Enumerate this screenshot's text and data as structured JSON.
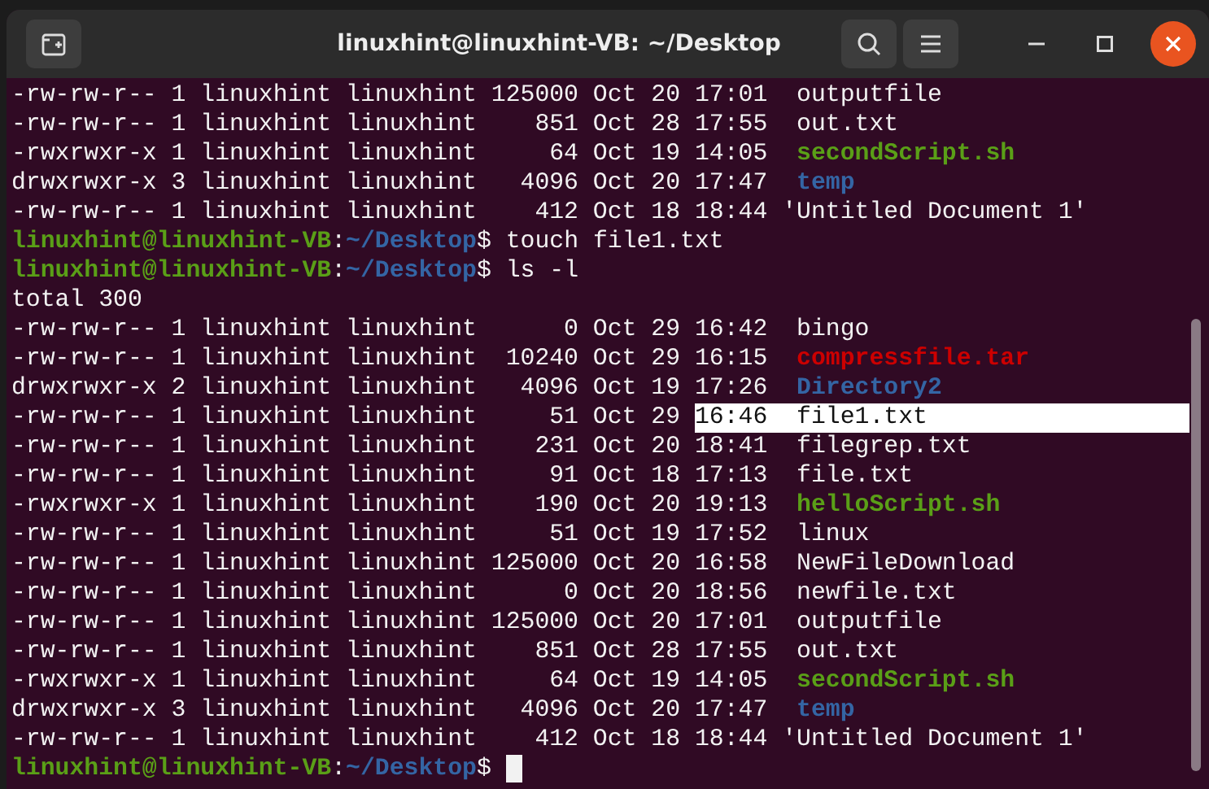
{
  "window": {
    "title": "linuxhint@linuxhint-VB: ~/Desktop"
  },
  "lines": [
    {
      "kind": "listing",
      "info": "-rw-rw-r-- 1 linuxhint linuxhint 125000 Oct 20",
      "time": "17:01",
      "file": {
        "name": "outputfile",
        "kind": "file"
      },
      "quoted": false,
      "selected": false
    },
    {
      "kind": "listing",
      "info": "-rw-rw-r-- 1 linuxhint linuxhint    851 Oct 28",
      "time": "17:55",
      "file": {
        "name": "out.txt",
        "kind": "file"
      },
      "quoted": false,
      "selected": false
    },
    {
      "kind": "listing",
      "info": "-rwxrwxr-x 1 linuxhint linuxhint     64 Oct 19",
      "time": "14:05",
      "file": {
        "name": "secondScript.sh",
        "kind": "executable"
      },
      "quoted": false,
      "selected": false
    },
    {
      "kind": "listing",
      "info": "drwxrwxr-x 3 linuxhint linuxhint   4096 Oct 20",
      "time": "17:47",
      "file": {
        "name": "temp",
        "kind": "directory"
      },
      "quoted": false,
      "selected": false
    },
    {
      "kind": "listing",
      "info": "-rw-rw-r-- 1 linuxhint linuxhint    412 Oct 18",
      "time": "18:44",
      "file": {
        "name": "'Untitled Document 1'",
        "kind": "file"
      },
      "quoted": true,
      "selected": false
    },
    {
      "kind": "prompt",
      "user": "linuxhint@linuxhint-VB",
      "separator": ":",
      "path": "~/Desktop",
      "symbol": "$",
      "command": "touch file1.txt",
      "cursor": false
    },
    {
      "kind": "prompt",
      "user": "linuxhint@linuxhint-VB",
      "separator": ":",
      "path": "~/Desktop",
      "symbol": "$",
      "command": "ls -l",
      "cursor": false
    },
    {
      "kind": "output",
      "text": "total 300"
    },
    {
      "kind": "listing",
      "info": "-rw-rw-r-- 1 linuxhint linuxhint      0 Oct 29",
      "time": "16:42",
      "file": {
        "name": "bingo",
        "kind": "file"
      },
      "quoted": false,
      "selected": false
    },
    {
      "kind": "listing",
      "info": "-rw-rw-r-- 1 linuxhint linuxhint  10240 Oct 29",
      "time": "16:15",
      "file": {
        "name": "compressfile.tar",
        "kind": "archive"
      },
      "quoted": false,
      "selected": false
    },
    {
      "kind": "listing",
      "info": "drwxrwxr-x 2 linuxhint linuxhint   4096 Oct 19",
      "time": "17:26",
      "file": {
        "name": "Directory2",
        "kind": "directory"
      },
      "quoted": false,
      "selected": false
    },
    {
      "kind": "listing",
      "info": "-rw-rw-r-- 1 linuxhint linuxhint     51 Oct 29",
      "time": "16:46",
      "file": {
        "name": "file1.txt",
        "kind": "file"
      },
      "quoted": false,
      "selected": true
    },
    {
      "kind": "listing",
      "info": "-rw-rw-r-- 1 linuxhint linuxhint    231 Oct 20",
      "time": "18:41",
      "file": {
        "name": "filegrep.txt",
        "kind": "file"
      },
      "quoted": false,
      "selected": false
    },
    {
      "kind": "listing",
      "info": "-rw-rw-r-- 1 linuxhint linuxhint     91 Oct 18",
      "time": "17:13",
      "file": {
        "name": "file.txt",
        "kind": "file"
      },
      "quoted": false,
      "selected": false
    },
    {
      "kind": "listing",
      "info": "-rwxrwxr-x 1 linuxhint linuxhint    190 Oct 20",
      "time": "19:13",
      "file": {
        "name": "helloScript.sh",
        "kind": "executable"
      },
      "quoted": false,
      "selected": false
    },
    {
      "kind": "listing",
      "info": "-rw-rw-r-- 1 linuxhint linuxhint     51 Oct 19",
      "time": "17:52",
      "file": {
        "name": "linux",
        "kind": "file"
      },
      "quoted": false,
      "selected": false
    },
    {
      "kind": "listing",
      "info": "-rw-rw-r-- 1 linuxhint linuxhint 125000 Oct 20",
      "time": "16:58",
      "file": {
        "name": "NewFileDownload",
        "kind": "file"
      },
      "quoted": false,
      "selected": false
    },
    {
      "kind": "listing",
      "info": "-rw-rw-r-- 1 linuxhint linuxhint      0 Oct 20",
      "time": "18:56",
      "file": {
        "name": "newfile.txt",
        "kind": "file"
      },
      "quoted": false,
      "selected": false
    },
    {
      "kind": "listing",
      "info": "-rw-rw-r-- 1 linuxhint linuxhint 125000 Oct 20",
      "time": "17:01",
      "file": {
        "name": "outputfile",
        "kind": "file"
      },
      "quoted": false,
      "selected": false
    },
    {
      "kind": "listing",
      "info": "-rw-rw-r-- 1 linuxhint linuxhint    851 Oct 28",
      "time": "17:55",
      "file": {
        "name": "out.txt",
        "kind": "file"
      },
      "quoted": false,
      "selected": false
    },
    {
      "kind": "listing",
      "info": "-rwxrwxr-x 1 linuxhint linuxhint     64 Oct 19",
      "time": "14:05",
      "file": {
        "name": "secondScript.sh",
        "kind": "executable"
      },
      "quoted": false,
      "selected": false
    },
    {
      "kind": "listing",
      "info": "drwxrwxr-x 3 linuxhint linuxhint   4096 Oct 20",
      "time": "17:47",
      "file": {
        "name": "temp",
        "kind": "directory"
      },
      "quoted": false,
      "selected": false
    },
    {
      "kind": "listing",
      "info": "-rw-rw-r-- 1 linuxhint linuxhint    412 Oct 18",
      "time": "18:44",
      "file": {
        "name": "'Untitled Document 1'",
        "kind": "file"
      },
      "quoted": true,
      "selected": false
    },
    {
      "kind": "prompt",
      "user": "linuxhint@linuxhint-VB",
      "separator": ":",
      "path": "~/Desktop",
      "symbol": "$",
      "cursor": true
    }
  ]
}
